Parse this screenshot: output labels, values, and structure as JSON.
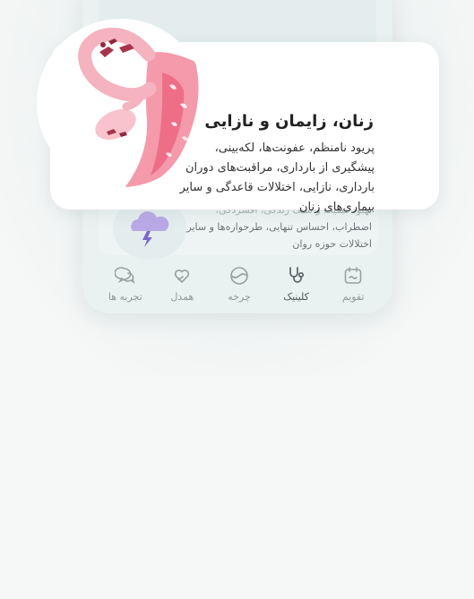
{
  "popup": {
    "title": "زنان، زایمان و نازایی",
    "description": "پریود نامنظم، عفونت‌ها، لکه‌بینی، پیشگیری از بارداری، مراقبت‌های دوران بارداری، نازایی، اختلالات قاعدگی و سایر بیماری‌های زنان",
    "illustration_icon": "uterus-icon"
  },
  "background_card": {
    "faded_line": "بهبود کیفیت و سبک زندگی، افسردگی،",
    "text": "اضطراب، احساس تنهایی، طرحواره‌ها و سایر اختلالات حوزه روان",
    "icon": "storm-cloud-icon"
  },
  "bottom_nav": {
    "items": [
      {
        "label": "تقویم",
        "icon": "calendar-icon",
        "active": false
      },
      {
        "label": "کلینیک",
        "icon": "stethoscope-icon",
        "active": true
      },
      {
        "label": "چرخه",
        "icon": "cycle-icon",
        "active": false
      },
      {
        "label": "همدل",
        "icon": "heart-hands-icon",
        "active": false
      },
      {
        "label": "تجربه ها",
        "icon": "chat-bubbles-icon",
        "active": false
      }
    ]
  },
  "colors": {
    "accent_pink": "#f08aa0",
    "dark_pink": "#a8344b",
    "lavender": "#b9a8e6",
    "nav_icon": "#97a1a1"
  }
}
